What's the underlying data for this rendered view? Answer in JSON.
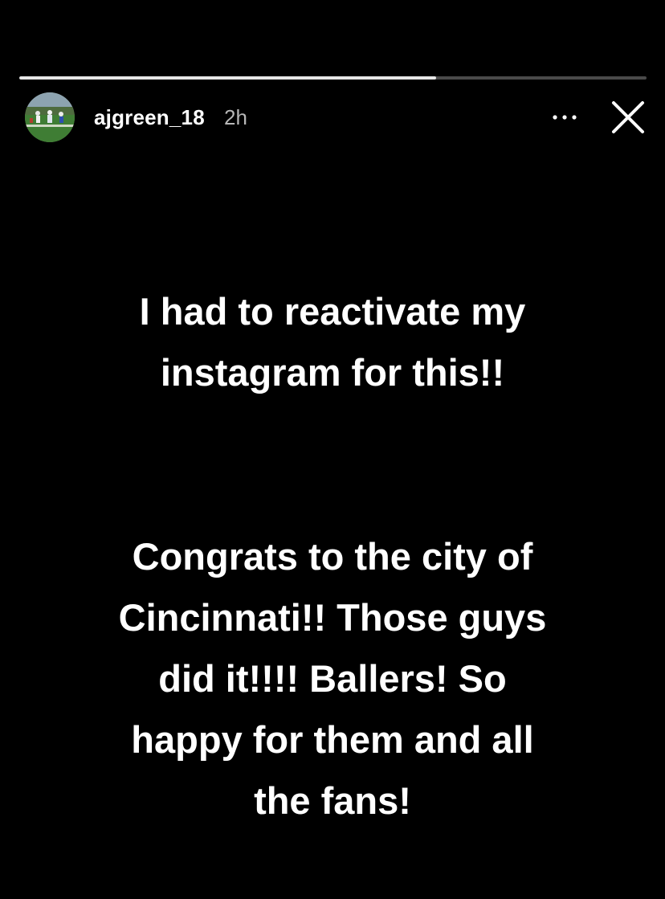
{
  "story": {
    "progress": [
      0.665
    ],
    "username": "ajgreen_18",
    "timestamp": "2h",
    "avatar_icon": "profile-photo-football-field",
    "more_icon": "more-horizontal-icon",
    "close_icon": "close-icon",
    "paragraph_1": "I had to reactivate my\ninstagram for this!!",
    "paragraph_2": "Congrats to the city of\nCincinnati!! Those guys\ndid it!!!! Ballers! So\nhappy for them and all\nthe fans!"
  },
  "colors": {
    "background": "#000000",
    "text": "#ffffff",
    "timestamp": "#b7b7b7",
    "progress_track": "#4a4a4a",
    "progress_fill": "#e6e6e6"
  }
}
